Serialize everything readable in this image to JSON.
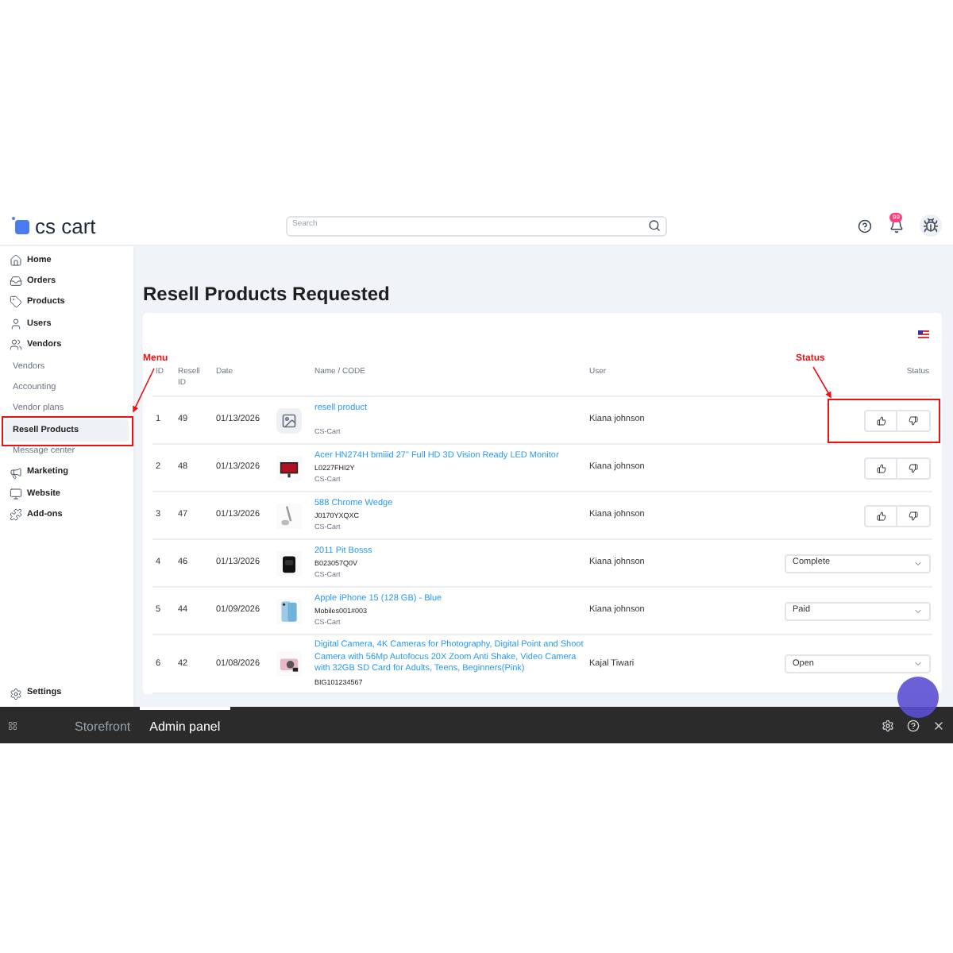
{
  "header": {
    "logo": "cs cart",
    "search": {
      "placeholder": "Search"
    },
    "notification_count": "99"
  },
  "sidebar": {
    "main_items": [
      {
        "label": "Home"
      },
      {
        "label": "Orders"
      },
      {
        "label": "Products"
      },
      {
        "label": "Users"
      },
      {
        "label": "Vendors"
      }
    ],
    "sub_items": [
      {
        "label": "Vendors",
        "selected": false
      },
      {
        "label": "Accounting",
        "selected": false
      },
      {
        "label": "Vendor plans",
        "selected": false
      },
      {
        "label": "Resell Products",
        "selected": true
      },
      {
        "label": "Message center",
        "selected": false
      }
    ],
    "more_items": [
      {
        "label": "Marketing"
      },
      {
        "label": "Website"
      },
      {
        "label": "Add-ons"
      }
    ],
    "settings": "Settings"
  },
  "page_title": "Resell Products Requested",
  "table": {
    "columns": [
      "ID",
      "Resell ID",
      "Date",
      "Name / CODE",
      "User",
      "Status"
    ],
    "rows": [
      {
        "id": "1",
        "resell_id": "49",
        "date": "01/13/2026",
        "thumbnail": {
          "kind": "placeholder"
        },
        "name": "resell product",
        "vendor": "CS-Cart",
        "user": "Kiana johnson",
        "status": {
          "kind": "buttons"
        }
      },
      {
        "id": "2",
        "resell_id": "48",
        "date": "01/13/2026",
        "name": "Acer HN274H bmiiid 27\" Full HD 3D Vision Ready LED Monitor",
        "code": "L0227FHI2Y",
        "vendor": "CS-Cart",
        "user": "Kiana johnson",
        "status": {
          "kind": "buttons"
        }
      },
      {
        "id": "3",
        "resell_id": "47",
        "date": "01/13/2026",
        "name": "588 Chrome Wedge",
        "code": "J0170YXQXC",
        "vendor": "CS-Cart",
        "user": "Kiana johnson",
        "status": {
          "kind": "buttons"
        }
      },
      {
        "id": "4",
        "resell_id": "46",
        "date": "01/13/2026",
        "name": "2011 Pit Bosss",
        "code": "B023057Q0V",
        "vendor": "CS-Cart",
        "user": "Kiana johnson",
        "status": {
          "kind": "select",
          "value": "Complete"
        }
      },
      {
        "id": "5",
        "resell_id": "44",
        "date": "01/09/2026",
        "name": "Apple iPhone 15 (128 GB) - Blue",
        "code": "Mobiles001#003",
        "vendor": "CS-Cart",
        "user": "Kiana johnson",
        "status": {
          "kind": "select",
          "value": "Paid"
        }
      },
      {
        "id": "6",
        "resell_id": "42",
        "date": "01/08/2026",
        "name": "Digital Camera, 4K Cameras for Photography, Digital Point and Shoot Camera with 56Mp Autofocus 20X Zoom Anti Shake, Video Camera with 32GB SD Card for Adults, Teens, Beginners(Pink)",
        "code": "BIG101234567",
        "user": "Kajal Tiwari",
        "status": {
          "kind": "select",
          "value": "Open"
        }
      }
    ]
  },
  "annotations": [
    {
      "label": "Menu"
    },
    {
      "label": "Status"
    }
  ],
  "bottom_bar": {
    "tabs": [
      {
        "label": "Storefront",
        "selected": false
      },
      {
        "label": "Admin panel",
        "selected": true
      }
    ]
  }
}
